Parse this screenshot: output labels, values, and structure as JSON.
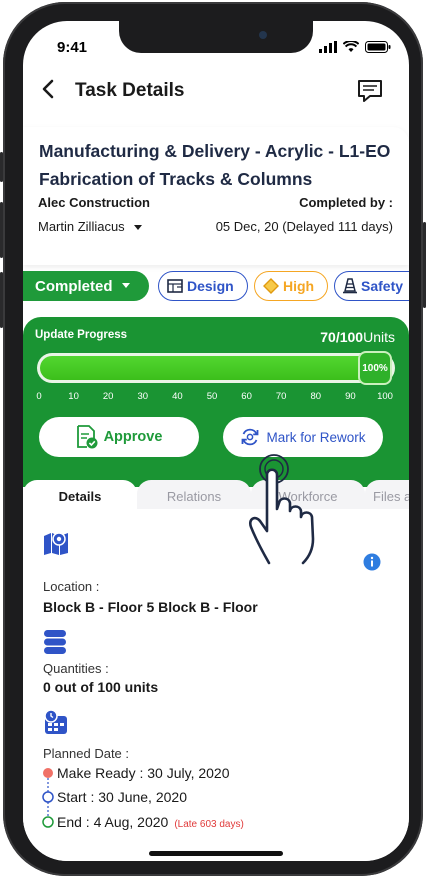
{
  "status_bar": {
    "time": "9:41"
  },
  "header": {
    "title": "Task Details",
    "back_icon": "chevron-left-icon",
    "chat_icon": "chat-icon"
  },
  "task": {
    "title": "Manufacturing & Delivery - Acrylic - L1-EO Fabrication of Tracks & Columns",
    "company": "Alec Construction",
    "person": "Martin Zilliacus",
    "completed_by_label": "Completed by :",
    "completed_date": "05 Dec, 20 (Delayed 111 days)"
  },
  "chips": {
    "status": "Completed",
    "design": "Design",
    "priority": "High",
    "safety": "Safety",
    "colors": {
      "status": "#1f9a3a",
      "design": "#2f54c7",
      "priority": "#f5a623",
      "safety": "#2f54c7"
    }
  },
  "progress": {
    "label": "Update  Progress",
    "value_text": "70/100",
    "unit_text": "Units",
    "fill_fraction": 1.0,
    "knob_text": "100%",
    "ticks": [
      "0",
      "10",
      "20",
      "30",
      "40",
      "50",
      "60",
      "70",
      "80",
      "90",
      "100"
    ]
  },
  "actions": {
    "approve": "Approve",
    "rework": "Mark for Rework"
  },
  "tabs": [
    "Details",
    "Relations",
    "Workforce",
    "Files a"
  ],
  "details": {
    "location_label": "Location :",
    "location_value": "Block B - Floor 5 Block B - Floor",
    "quantities_label": "Quantities :",
    "quantities_value": "0 out of 100 units",
    "planned_label": "Planned Date :",
    "make_ready": "Make Ready : 30 July, 2020",
    "start": "Start : 30 June, 2020",
    "end": "End : 4 Aug, 2020",
    "late": "(Late 603 days)"
  }
}
